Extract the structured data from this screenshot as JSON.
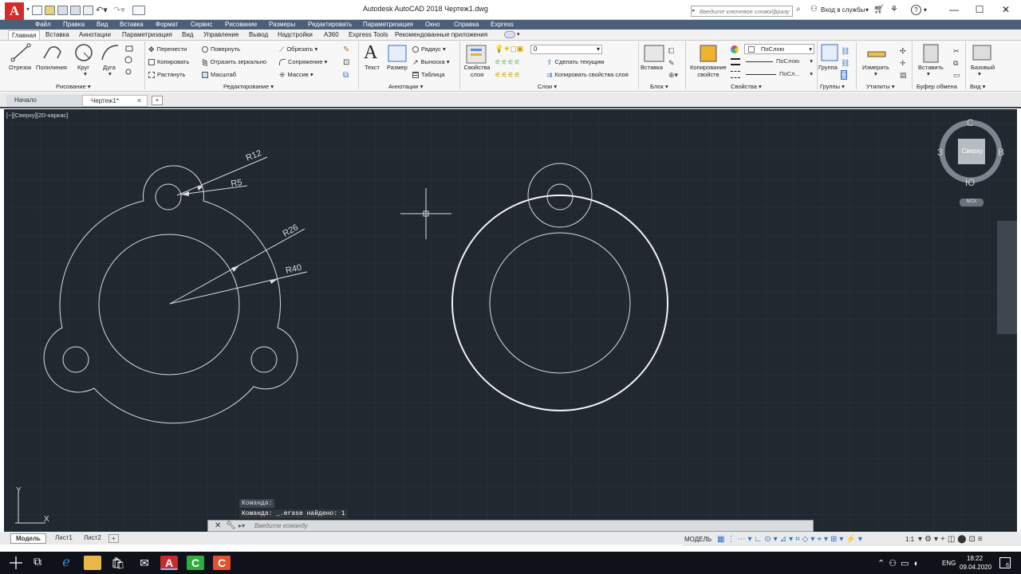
{
  "titlebar": {
    "logo_letter": "A",
    "title": "Autodesk AutoCAD 2018     Чертеж1.dwg",
    "search_placeholder": "Введите ключевое слово/фразу",
    "login": "Вход в службы",
    "minimize": "—",
    "maximize": "☐",
    "close": "✕"
  },
  "menubar": [
    "Файл",
    "Правка",
    "Вид",
    "Вставка",
    "Формат",
    "Сервис",
    "Рисование",
    "Размеры",
    "Редактировать",
    "Параметризация",
    "Окно",
    "Справка",
    "Express"
  ],
  "ribbon_tabs": [
    "Главная",
    "Вставка",
    "Аннотации",
    "Параметризация",
    "Вид",
    "Управление",
    "Вывод",
    "Надстройки",
    "A360",
    "Express Tools",
    "Рекомендованные приложения"
  ],
  "ribbon": {
    "draw": {
      "buttons": [
        "Отрезок",
        "Полилиния",
        "Круг",
        "Дуга"
      ],
      "panel": "Рисование ▾"
    },
    "edit": {
      "col1": [
        "Перенести",
        "Копировать",
        "Растянуть"
      ],
      "col2": [
        "Повернуть",
        "Отразить зеркально",
        "Масштаб"
      ],
      "col3": [
        "Обрезать",
        "Сопряжение",
        "Массив"
      ],
      "panel": "Редактирование ▾"
    },
    "annot": {
      "big": [
        "Текст",
        "Размер"
      ],
      "col": [
        "Радиус",
        "Выноска",
        "Таблица"
      ],
      "panel": "Аннотации ▾"
    },
    "layers": {
      "big": "Свойства слоя",
      "layer_value": "0",
      "make_current": "Сделать текущим",
      "copy_props": "Копировать свойства слоя",
      "panel": "Слои ▾"
    },
    "block": {
      "big": "Вставка",
      "panel": "Блок ▾"
    },
    "props": {
      "big": "Копирование свойств",
      "color": "ПоСлою",
      "ltype": "ПоСлою",
      "lweight": "ПоСл...",
      "panel": "Свойства ▾"
    },
    "groups": {
      "big": "Группа",
      "panel": "Группы ▾"
    },
    "utils": {
      "big": "Измерить",
      "panel": "Утилиты ▾"
    },
    "clipboard": {
      "big": "Вставить",
      "panel": "Буфер обмена"
    },
    "view": {
      "big": "Базовый",
      "panel": "Вид ▾"
    }
  },
  "doc_tabs": {
    "start": "Начало",
    "drawing": "Чертеж1*",
    "new": "+"
  },
  "viewport": {
    "label": "[−][Сверху][2D-каркас]",
    "viewcube": {
      "n": "С",
      "s": "Ю",
      "w": "З",
      "e": "В",
      "face": "Сверху",
      "ucs": "МСК"
    },
    "dims": {
      "r12": "R12",
      "r5": "R5",
      "r26": "R26",
      "r40": "R40"
    },
    "axis_y": "Y",
    "axis_x": "X"
  },
  "command": {
    "line1": "Команда:",
    "line2": "Команда: _.erase найдено: 1",
    "placeholder": "Введите команду"
  },
  "layout_tabs": [
    "Модель",
    "Лист1",
    "Лист2",
    "+"
  ],
  "status": {
    "model": "МОДЕЛЬ",
    "scale": "1:1"
  },
  "taskbar": {
    "lang": "ENG",
    "time": "18:22",
    "date": "09.04.2020",
    "notif": "6"
  }
}
